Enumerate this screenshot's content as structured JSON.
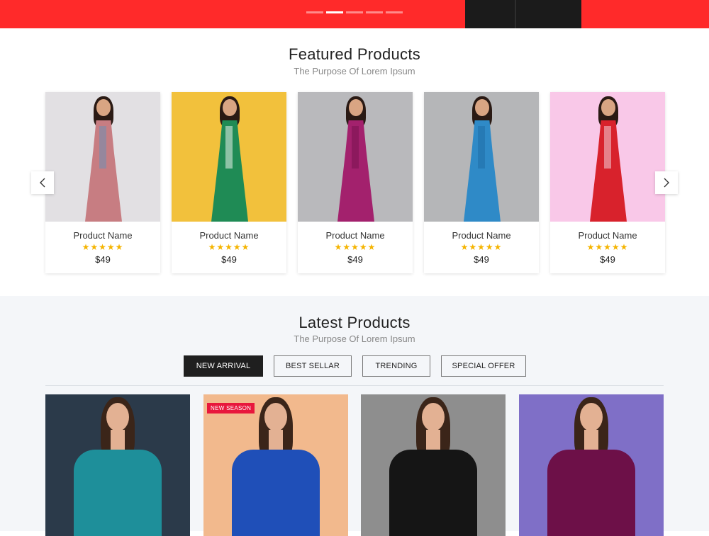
{
  "hero": {
    "slides": [
      "slide-1",
      "slide-2",
      "slide-3",
      "slide-4",
      "slide-5"
    ],
    "active_slide": 2
  },
  "featured": {
    "title": "Featured Products",
    "subtitle": "The Purpose Of Lorem Ipsum",
    "prev_icon": "chevron-left-icon",
    "next_icon": "chevron-right-icon",
    "products": [
      {
        "name": "Product Name",
        "rating": "★★★★★",
        "price": "$49",
        "bg": "#e2e0e3",
        "dress": "#c77d82",
        "accent": "#6e8fb5"
      },
      {
        "name": "Product Name",
        "rating": "★★★★★",
        "price": "$49",
        "bg": "#f2c13c",
        "dress": "#1f8b55",
        "accent": "#e8f0ea"
      },
      {
        "name": "Product Name",
        "rating": "★★★★★",
        "price": "$49",
        "bg": "#b9b9bc",
        "dress": "#a3216d",
        "accent": "#7a1450"
      },
      {
        "name": "Product Name",
        "rating": "★★★★★",
        "price": "$49",
        "bg": "#b5b6b8",
        "dress": "#2f8ac7",
        "accent": "#1f6ea5"
      },
      {
        "name": "Product Name",
        "rating": "★★★★★",
        "price": "$49",
        "bg": "#f9c8e8",
        "dress": "#d8222c",
        "accent": "#f3d0d8"
      }
    ]
  },
  "latest": {
    "title": "Latest Products",
    "subtitle": "The Purpose Of Lorem Ipsum",
    "tabs": [
      {
        "label": "NEW ARRIVAL",
        "active": true
      },
      {
        "label": "BEST SELLAR",
        "active": false
      },
      {
        "label": "TRENDING",
        "active": false
      },
      {
        "label": "SPECIAL OFFER",
        "active": false
      }
    ],
    "products": [
      {
        "badge": "",
        "bg": "#2b3a4a",
        "dress": "#1e8f9a"
      },
      {
        "badge": "NEW SEASON",
        "bg": "#f2b98d",
        "dress": "#1f4fb8"
      },
      {
        "badge": "",
        "bg": "#8e8e8e",
        "dress": "#151515"
      },
      {
        "badge": "",
        "bg": "#7f6fc7",
        "dress": "#6d1048"
      }
    ]
  },
  "colors": {
    "hero": "#ff2a2a",
    "star": "#f5b400",
    "badge": "#e8173c",
    "active_tab": "#1f1f1f"
  }
}
